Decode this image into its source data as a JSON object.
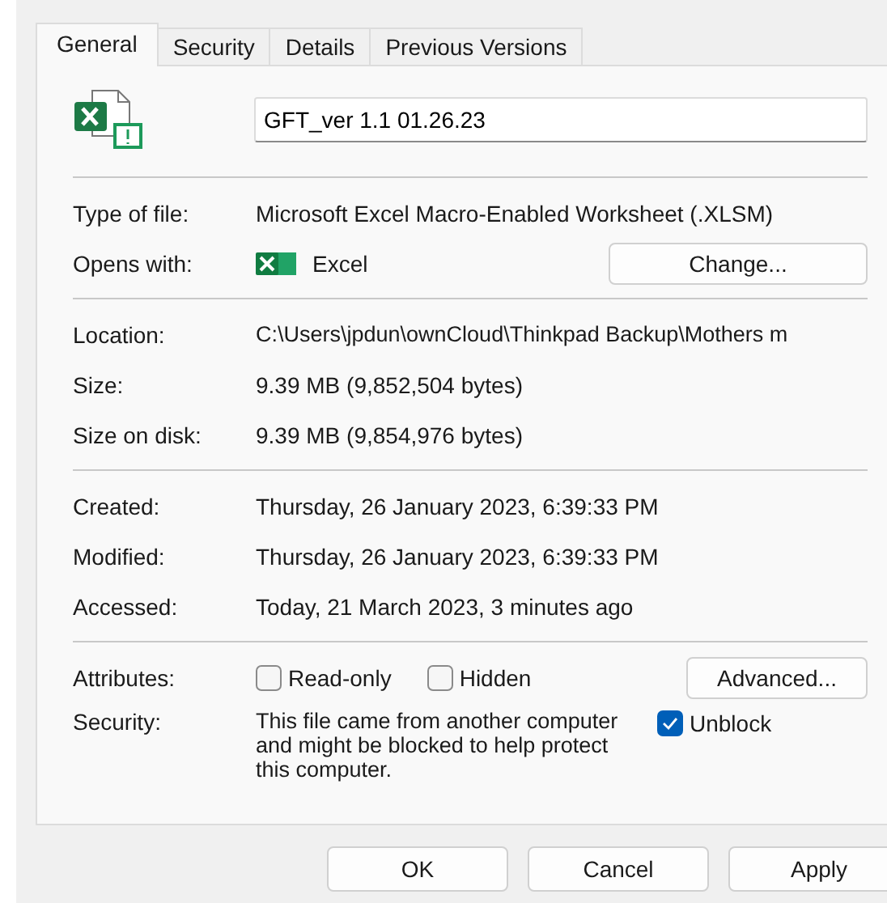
{
  "tabs": [
    {
      "label": "General",
      "selected": true
    },
    {
      "label": "Security",
      "selected": false
    },
    {
      "label": "Details",
      "selected": false
    },
    {
      "label": "Previous Versions",
      "selected": false
    }
  ],
  "file_name": {
    "value": "GFT_ver 1.1 01.26.23"
  },
  "type_of_file": {
    "label": "Type of file:",
    "value": "Microsoft Excel Macro-Enabled Worksheet (.XLSM)"
  },
  "opens_with": {
    "label": "Opens with:",
    "app": "Excel",
    "button": "Change..."
  },
  "location_info": [
    {
      "label": "Location:",
      "value": "C:\\Users\\jpdun\\ownCloud\\Thinkpad Backup\\Mothers m"
    },
    {
      "label": "Size:",
      "value": "9.39 MB (9,852,504 bytes)"
    },
    {
      "label": "Size on disk:",
      "value": "9.39 MB (9,854,976 bytes)"
    }
  ],
  "dates": [
    {
      "label": "Created:",
      "value": "Thursday, 26 January 2023, 6:39:33 PM"
    },
    {
      "label": "Modified:",
      "value": "Thursday, 26 January 2023, 6:39:33 PM"
    },
    {
      "label": "Accessed:",
      "value": "Today, 21 March 2023, 3 minutes ago"
    }
  ],
  "attributes": {
    "label": "Attributes:",
    "options": [
      {
        "label": "Read-only",
        "checked": false
      },
      {
        "label": "Hidden",
        "checked": false
      }
    ],
    "button": "Advanced..."
  },
  "security": {
    "label": "Security:",
    "text": "This file came from another computer and might be blocked to help protect this computer.",
    "unblock": {
      "label": "Unblock",
      "checked": true
    }
  },
  "buttons": [
    "OK",
    "Cancel",
    "Apply"
  ]
}
